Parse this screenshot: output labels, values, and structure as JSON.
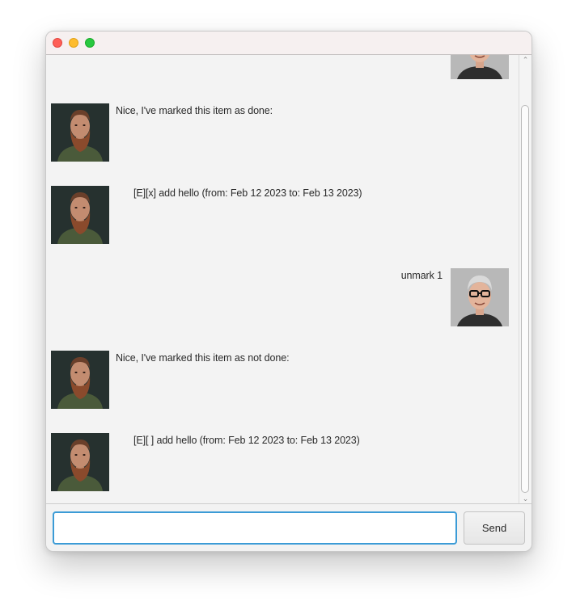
{
  "chat": {
    "messages": [
      {
        "sender": "user",
        "text": "",
        "avatar": "user-avatar"
      },
      {
        "sender": "bot",
        "text": "Nice, I've marked this item as done:",
        "avatar": "bot-avatar"
      },
      {
        "sender": "bot",
        "text": "[E][x] add hello (from: Feb 12 2023 to: Feb 13 2023)",
        "avatar": "bot-avatar"
      },
      {
        "sender": "user",
        "text": "unmark 1",
        "avatar": "user-avatar"
      },
      {
        "sender": "bot",
        "text": "Nice, I've marked this item as not done:",
        "avatar": "bot-avatar"
      },
      {
        "sender": "bot",
        "text": "[E][ ] add hello (from: Feb 12 2023 to: Feb 13 2023)",
        "avatar": "bot-avatar"
      }
    ]
  },
  "input": {
    "value": "",
    "placeholder": ""
  },
  "send_button": {
    "label": "Send"
  },
  "colors": {
    "input_focus": "#3b9bd6",
    "window_bg": "#f3f3f3",
    "close": "#fe5f57",
    "minimize": "#febc2e",
    "maximize": "#28c840"
  }
}
